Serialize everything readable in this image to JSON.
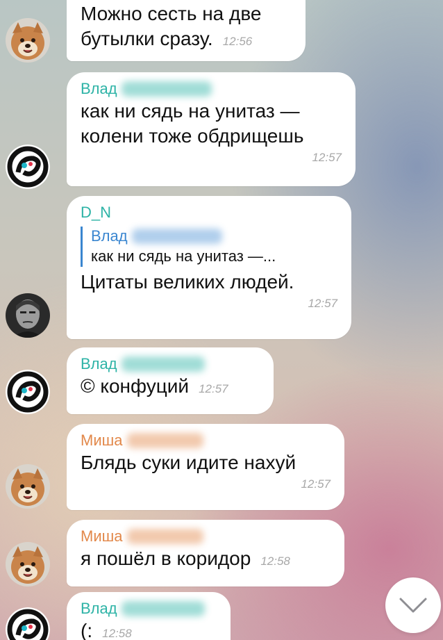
{
  "messages": [
    {
      "sender": "",
      "lines": [
        "Можно сесть на две",
        "бутылки сразу."
      ],
      "time": "12:56",
      "avatar": "shiba"
    },
    {
      "sender": "Влад",
      "sender_color": "#2db3a6",
      "lines": [
        "как ни сядь на унитаз —",
        "колени тоже обдрищешь"
      ],
      "time": "12:57",
      "avatar": "spiral"
    },
    {
      "sender": "D_N",
      "sender_color": "#2db3a6",
      "quote": {
        "name": "Влад",
        "text": "как ни сядь на унитаз —..."
      },
      "lines": [
        "Цитаты великих людей."
      ],
      "time": "12:57",
      "avatar": "man"
    },
    {
      "sender": "Влад",
      "sender_color": "#2db3a6",
      "lines": [
        "© конфуций"
      ],
      "time": "12:57",
      "avatar": "spiral"
    },
    {
      "sender": "Миша",
      "sender_color": "#e2884a",
      "lines": [
        "Блядь суки идите нахуй"
      ],
      "time": "12:57",
      "avatar": "shiba"
    },
    {
      "sender": "Миша",
      "sender_color": "#e2884a",
      "lines": [
        "я пошёл в коридор"
      ],
      "time": "12:58",
      "avatar": "shiba"
    },
    {
      "sender": "Влад",
      "sender_color": "#2db3a6",
      "lines": [
        "(:"
      ],
      "time": "12:58",
      "avatar": "spiral"
    }
  ],
  "colors": {
    "accent": "#3a86d0",
    "teal": "#2db3a6",
    "orange": "#e2884a"
  },
  "icons": {
    "scroll_down": "chevron-down-icon"
  }
}
